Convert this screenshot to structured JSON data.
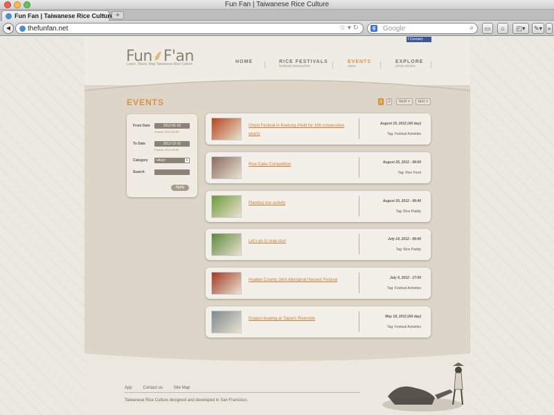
{
  "window": {
    "title": "Fun Fan | Taiwanese Rice Culture"
  },
  "tab": {
    "label": "Fun Fan | Taiwanese Rice Culture",
    "close": "×",
    "new_tab": "+"
  },
  "toolbar": {
    "url": "thefunfan.net",
    "search_placeholder": "Google",
    "search_engine": "g"
  },
  "social": {
    "connect_label": "Connect"
  },
  "brand": {
    "logo_part1": "Fun",
    "logo_part2": "F'an",
    "tagline": "Learn, Share, Map Taiwanese Rice Culture"
  },
  "nav": [
    {
      "label": "HOME",
      "sub": ""
    },
    {
      "label": "RICE FESTIVALS",
      "sub": "festivals introduction"
    },
    {
      "label": "EVENTS",
      "sub": "news"
    },
    {
      "label": "EXPLORE",
      "sub": "photo stories"
    }
  ],
  "page": {
    "heading": "EVENTS"
  },
  "pagination": {
    "pages": [
      "1",
      "2"
    ],
    "next": "next »",
    "last": "last »"
  },
  "filter": {
    "from_label": "From Date",
    "from_value": "2012-01-01",
    "from_hint": "Format: 2012-09-09",
    "to_label": "To Date",
    "to_value": "2012-12-31",
    "to_hint": "Format: 2012-09-09",
    "category_label": "Category",
    "category_value": "<Any>",
    "search_label": "Search",
    "search_value": "",
    "apply_label": "Apply"
  },
  "events": [
    {
      "title": "Ghost Festival in Keelung (Held for 166 consecutive years)",
      "date": "August 15, 2012 (All day)",
      "tag": "Tag: Festival Activities",
      "thumb_color": "#b5451c"
    },
    {
      "title": "Rice Cake Competition",
      "date": "August 25, 2012 - 08:00",
      "tag": "Tag: Rice Food",
      "thumb_color": "#8a6b63"
    },
    {
      "title": "Planting rice activity",
      "date": "August 20, 2012 - 08:40",
      "tag": "Tag: Rice Paddy",
      "thumb_color": "#6f9a3a"
    },
    {
      "title": "Let's go to reap rice!",
      "date": "July 14, 2012 - 08:40",
      "tag": "Tag: Rice Paddy",
      "thumb_color": "#5f8a3e"
    },
    {
      "title": "Hualien County Joint Aboriginal Harvest Festival",
      "date": "July 6, 2012 - 17:00",
      "tag": "Tag: Festival Activities",
      "thumb_color": "#a33a26"
    },
    {
      "title": "Dragon-boating at Taipei's Riverside",
      "date": "May 18, 2012 (All day)",
      "tag": "Tag: Festival Activities",
      "thumb_color": "#7b8a8e"
    }
  ],
  "footer": {
    "links": [
      "App",
      "Contact us",
      "Site Map"
    ],
    "credit": "Taiwanese Rice Culture designed and developed in San Francisco."
  },
  "colors": {
    "accent": "#d9923f",
    "link": "#d07a2f",
    "panel": "#f0ece3",
    "band": "#ddd6c8"
  }
}
